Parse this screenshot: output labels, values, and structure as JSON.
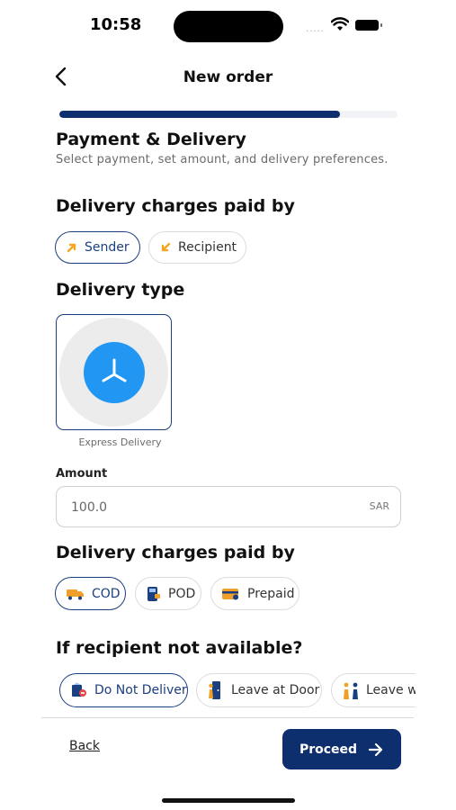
{
  "status_bar": {
    "time": "10:58",
    "dots": "....."
  },
  "header": {
    "title": "New order"
  },
  "progress": {
    "value": 0.83
  },
  "section": {
    "title": "Payment & Delivery",
    "subtitle": "Select payment, set amount, and delivery preferences."
  },
  "charges_paid_by": {
    "heading": "Delivery charges paid by",
    "options": [
      {
        "label": "Sender",
        "icon": "arrow-out-icon",
        "selected": true
      },
      {
        "label": "Recipient",
        "icon": "arrow-in-icon",
        "selected": false
      }
    ]
  },
  "delivery_type": {
    "heading": "Delivery type",
    "selected": {
      "label": "Express Delivery",
      "icon": "clock-icon"
    }
  },
  "amount": {
    "label": "Amount",
    "value": "100.0",
    "unit": "SAR"
  },
  "payment_method": {
    "heading": "Delivery charges paid by",
    "options": [
      {
        "label": "COD",
        "icon": "truck-icon",
        "selected": true
      },
      {
        "label": "POD",
        "icon": "pos-icon",
        "selected": false
      },
      {
        "label": "Prepaid",
        "icon": "card-icon",
        "selected": false
      }
    ]
  },
  "recipient_unavailable": {
    "heading": "If recipient not available?",
    "options": [
      {
        "label": "Do Not Deliver",
        "icon": "no-deliver-icon",
        "selected": true
      },
      {
        "label": "Leave at Door",
        "icon": "door-icon",
        "selected": false
      },
      {
        "label": "Leave wit",
        "icon": "handover-icon",
        "selected": false
      }
    ]
  },
  "footer": {
    "back_label": "Back",
    "proceed_label": "Proceed"
  },
  "colors": {
    "primary": "#0d2f6e",
    "accent_blue": "#2196f3",
    "orange": "#f5a623"
  }
}
